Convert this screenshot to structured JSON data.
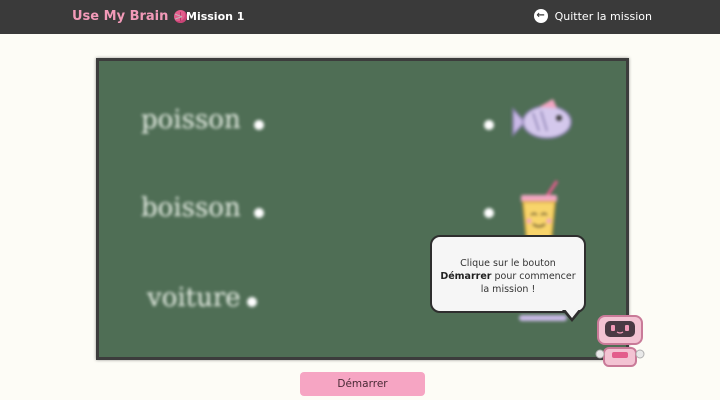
{
  "header": {
    "brand": "Use My Brain",
    "separator": ">",
    "breadcrumb": "Mission 1",
    "quit_label": "Quitter la mission"
  },
  "board": {
    "words": [
      "poisson",
      "boisson",
      "voiture"
    ],
    "images": [
      "fish-icon",
      "drink-icon",
      "car-icon"
    ]
  },
  "bubble": {
    "line1": "Clique sur le bouton",
    "bold": "Démarrer",
    "line2": " pour commencer",
    "line3": "la mission !"
  },
  "start_label": "Démarrer",
  "colors": {
    "topbar": "#3a3a3a",
    "brand": "#f29ab8",
    "board": "#4f6e55",
    "button": "#f6a5c3",
    "background": "#fdfcf6"
  }
}
